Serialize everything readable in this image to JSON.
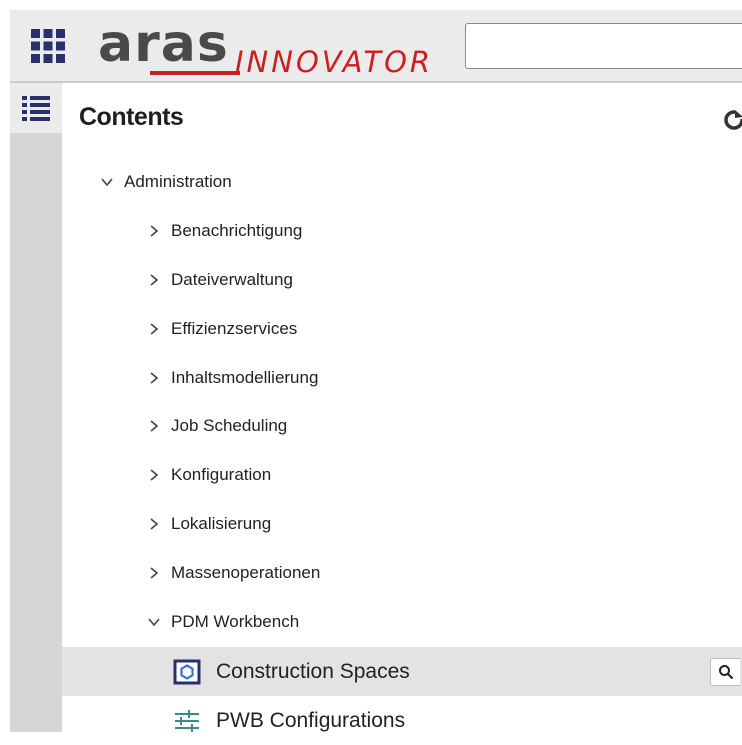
{
  "header": {
    "logo_brand": "aras",
    "logo_product": "INNOVATOR",
    "search_value": "",
    "icons": [
      "app-grid-icon"
    ]
  },
  "sidebar": {
    "icons": [
      "table-of-contents-icon"
    ]
  },
  "contents": {
    "title": "Contents",
    "tree": {
      "root_label": "Administration",
      "items": [
        {
          "label": "Benachrichtigung",
          "expanded": false
        },
        {
          "label": "Dateiverwaltung",
          "expanded": false
        },
        {
          "label": "Effizienzservices",
          "expanded": false
        },
        {
          "label": "Inhaltsmodellierung",
          "expanded": false
        },
        {
          "label": "Job Scheduling",
          "expanded": false
        },
        {
          "label": "Konfiguration",
          "expanded": false
        },
        {
          "label": "Lokalisierung",
          "expanded": false
        },
        {
          "label": "Massenoperationen",
          "expanded": false
        },
        {
          "label": "PDM Workbench",
          "expanded": true
        }
      ],
      "children": [
        {
          "label": "Construction Spaces",
          "selected": true,
          "icon": "construction-space-icon"
        },
        {
          "label": "PWB Configurations",
          "selected": false,
          "icon": "configuration-sliders-icon"
        }
      ]
    }
  },
  "colors": {
    "brand_red": "#cc1f1f",
    "logo_gray": "#4a4a4a",
    "header_bg": "#ebebeb",
    "selected_row": "#e3e3e3",
    "icon_navy": "#2a2f6e",
    "icon_blue": "#3b6fd8",
    "icon_teal": "#3b8a8a"
  }
}
